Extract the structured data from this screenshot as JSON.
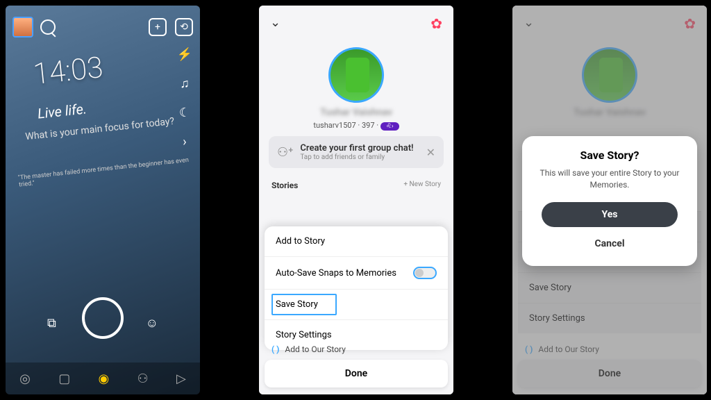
{
  "camera": {
    "time": "14:03",
    "slogan": "Live life.",
    "question": "What is your main focus for today?",
    "quote": "\"The master has failed more times than the beginner has even tried.\"",
    "nav": {
      "map": "◎",
      "chat": "▢",
      "camera": "◉",
      "friends": "⚇",
      "play": "▷"
    }
  },
  "profile": {
    "name": "Tushar Vaishnav",
    "username": "tusharv1507",
    "score": "397",
    "group_card": {
      "title": "Create your first group chat!",
      "subtitle": "Tap to add friends or family"
    },
    "stories_header": "Stories",
    "new_story": "+  New Story",
    "add_our_story": "Add to Our Story"
  },
  "sheet": {
    "add": "Add to Story",
    "autosave": "Auto-Save Snaps to Memories",
    "save": "Save Story",
    "settings": "Story Settings",
    "done": "Done"
  },
  "dialog": {
    "title": "Save Story?",
    "body": "This will save your entire Story to your Memories.",
    "yes": "Yes",
    "cancel": "Cancel"
  }
}
